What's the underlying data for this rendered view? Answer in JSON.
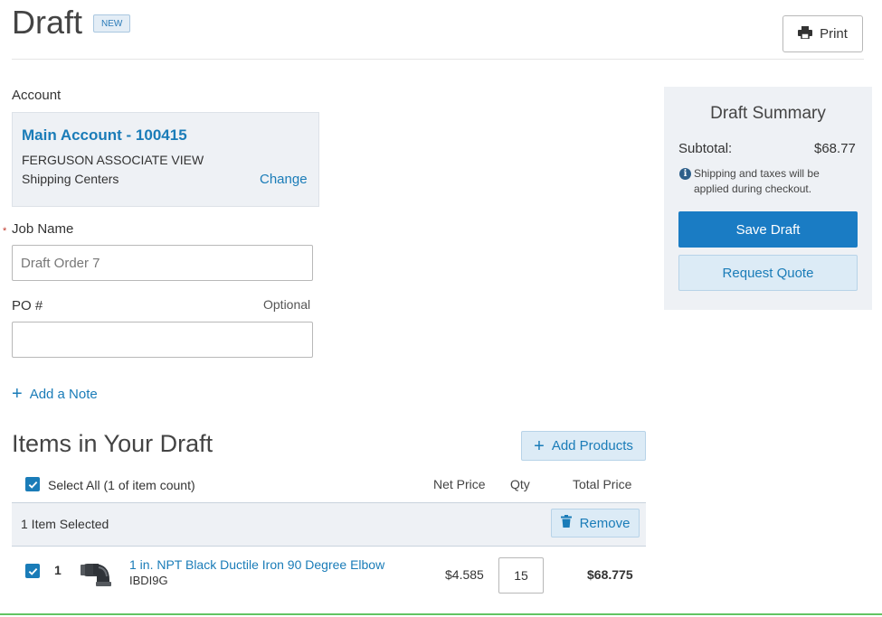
{
  "header": {
    "title": "Draft",
    "badge": "NEW",
    "print_label": "Print"
  },
  "account": {
    "label": "Account",
    "name": "Main Account - 100415",
    "line1": "FERGUSON ASSOCIATE VIEW",
    "line2": "Shipping Centers",
    "change_label": "Change"
  },
  "job": {
    "required_marker": "*",
    "label": "Job Name",
    "value": "Draft Order 7"
  },
  "po": {
    "label": "PO #",
    "optional_label": "Optional",
    "value": ""
  },
  "add_note_label": "Add a Note",
  "items": {
    "title": "Items in Your Draft",
    "add_products_label": "Add Products",
    "select_all_label": "Select All (1 of item count)",
    "columns": {
      "net_price": "Net Price",
      "qty": "Qty",
      "total_price": "Total Price"
    },
    "selected_text": "1 Item Selected",
    "remove_label": "Remove",
    "rows": [
      {
        "index": "1",
        "name": "1 in. NPT Black Ductile Iron 90 Degree Elbow",
        "sku": "IBDI9G",
        "net_price": "$4.585",
        "qty": "15",
        "total_price": "$68.775",
        "checked": true
      }
    ]
  },
  "summary": {
    "title": "Draft Summary",
    "subtotal_label": "Subtotal:",
    "subtotal_value": "$68.77",
    "info_text": "Shipping and taxes will be applied during checkout.",
    "save_draft_label": "Save Draft",
    "request_quote_label": "Request Quote"
  },
  "colors": {
    "accent": "#1a7cb8",
    "primary_button": "#1a7cc4",
    "panel_bg": "#eef1f5",
    "secondary_button_bg": "#dcebf6"
  }
}
